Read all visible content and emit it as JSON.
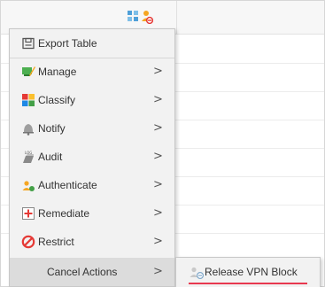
{
  "menu": {
    "items": [
      {
        "label": "Export Table",
        "icon": "export-table-icon",
        "has_submenu": false
      },
      {
        "label": "Manage",
        "icon": "manage-icon",
        "has_submenu": true
      },
      {
        "label": "Classify",
        "icon": "classify-icon",
        "has_submenu": true
      },
      {
        "label": "Notify",
        "icon": "bell-icon",
        "has_submenu": true
      },
      {
        "label": "Audit",
        "icon": "audit-log-icon",
        "has_submenu": true
      },
      {
        "label": "Authenticate",
        "icon": "authenticate-user-icon",
        "has_submenu": true
      },
      {
        "label": "Remediate",
        "icon": "remediate-plus-icon",
        "has_submenu": true
      },
      {
        "label": "Restrict",
        "icon": "restrict-icon",
        "has_submenu": true
      },
      {
        "label": "Cancel Actions",
        "icon": "",
        "has_submenu": true
      }
    ],
    "chevron": ">"
  },
  "submenu": {
    "items": [
      {
        "label": "Release VPN Block",
        "icon": "release-vpn-block-icon"
      }
    ]
  },
  "colors": {
    "accent_underline": "#e8384f",
    "manage_green": "#4caf50",
    "classify_red": "#e53935",
    "classify_yellow": "#fbc02d",
    "classify_blue": "#1e88e5",
    "classify_green": "#43a047",
    "restrict_red": "#e53935"
  }
}
